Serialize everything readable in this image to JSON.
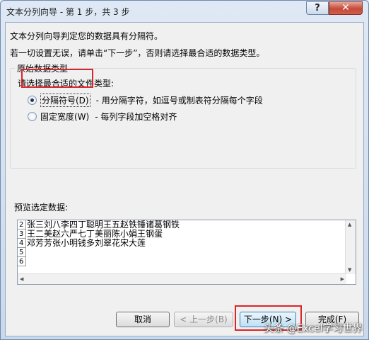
{
  "window": {
    "title": "文本分列向导 - 第 1 步，共 3 步",
    "help_label": "?",
    "close_label": "✕"
  },
  "intro": {
    "line1": "文本分列向导判定您的数据具有分隔符。",
    "line2": "若一切设置无误，请单击“下一步”，否则请选择最合适的数据类型。"
  },
  "group": {
    "legend": "原始数据类型",
    "prompt": "请选择最合适的文件类型:",
    "options": [
      {
        "label": "分隔符号(D)",
        "description": "- 用分隔字符，如逗号或制表符分隔每个字段",
        "checked": true
      },
      {
        "label": "固定宽度(W)",
        "description": "- 每列字段加空格对齐",
        "checked": false
      }
    ]
  },
  "preview": {
    "label": "预览选定数据:",
    "row_numbers": [
      "2",
      "3",
      "4",
      "5",
      "6"
    ],
    "rows": [
      "张三刘八李四丁聪明王五赵铁锤诸葛钢铁",
      "王二美赵六严七丁美丽陈小娟王钢蛋",
      "邓芳芳张小明钱多刘翠花宋大莲",
      "",
      ""
    ]
  },
  "buttons": {
    "cancel": "取消",
    "back": "< 上一步(B)",
    "next": "下一步(N) >",
    "finish": "完成(F)"
  },
  "watermark": "头条 @Excel学习世界",
  "colors": {
    "highlight_red": "#d9262b",
    "close_red": "#c44a38",
    "next_button_border": "#3c7fb1"
  }
}
